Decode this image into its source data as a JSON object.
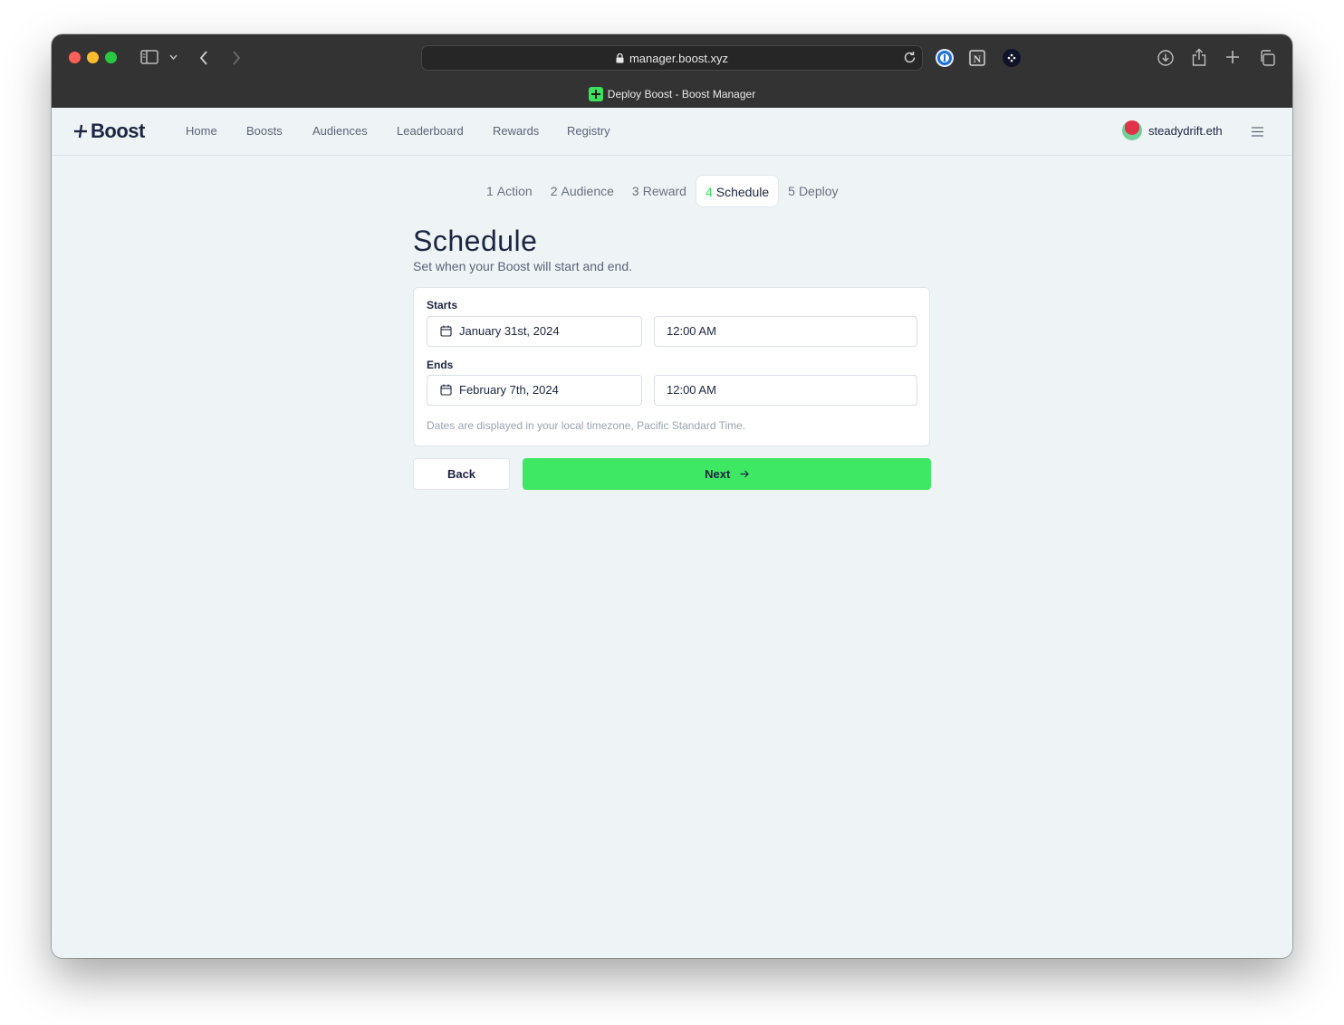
{
  "browser": {
    "url": "manager.boost.xyz",
    "tab_title": "Deploy Boost - Boost Manager"
  },
  "nav": {
    "logo": "Boost",
    "links": [
      "Home",
      "Boosts",
      "Audiences",
      "Leaderboard",
      "Rewards",
      "Registry"
    ],
    "username": "steadydrift.eth"
  },
  "steps": [
    {
      "num": "1",
      "label": "Action"
    },
    {
      "num": "2",
      "label": "Audience"
    },
    {
      "num": "3",
      "label": "Reward"
    },
    {
      "num": "4",
      "label": "Schedule"
    },
    {
      "num": "5",
      "label": "Deploy"
    }
  ],
  "page": {
    "title": "Schedule",
    "subtitle": "Set when your Boost will start and end."
  },
  "schedule": {
    "starts_label": "Starts",
    "start_date": "January 31st, 2024",
    "start_time": "12:00 AM",
    "ends_label": "Ends",
    "end_date": "February 7th, 2024",
    "end_time": "12:00 AM",
    "timezone_note": "Dates are displayed in your local timezone, Pacific Standard Time."
  },
  "actions": {
    "back": "Back",
    "next": "Next"
  },
  "colors": {
    "accent": "#3ee864",
    "text": "#1c2541",
    "background": "#eef3f6"
  }
}
